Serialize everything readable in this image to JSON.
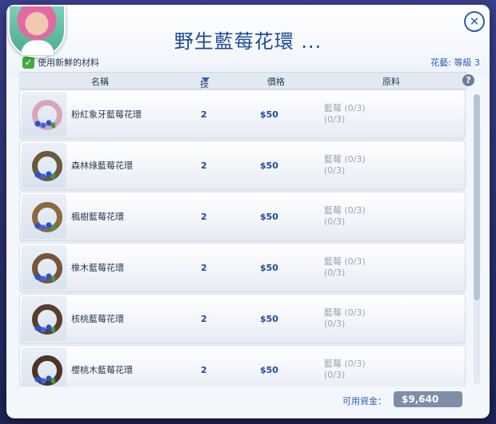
{
  "dialog": {
    "title": "野生藍莓花環 ...",
    "close_glyph": "✕"
  },
  "options": {
    "use_fresh_checked": true,
    "use_fresh_label": "使用新鮮的材料",
    "skill_info": "花藝: 等級 3"
  },
  "table": {
    "headers": {
      "name": "名稱",
      "skill": "技能",
      "price": "價格",
      "ingredients": "原料",
      "help_glyph": "?"
    },
    "rows": [
      {
        "name": "粉紅象牙藍莓花環",
        "skill": "2",
        "price": "$50",
        "ingredient": "藍莓 (0/3)",
        "ingredient_total": "(0/3)"
      },
      {
        "name": "森林綠藍莓花環",
        "skill": "2",
        "price": "$50",
        "ingredient": "藍莓 (0/3)",
        "ingredient_total": "(0/3)"
      },
      {
        "name": "楓樹藍莓花環",
        "skill": "2",
        "price": "$50",
        "ingredient": "藍莓 (0/3)",
        "ingredient_total": "(0/3)"
      },
      {
        "name": "橡木藍莓花環",
        "skill": "2",
        "price": "$50",
        "ingredient": "藍莓 (0/3)",
        "ingredient_total": "(0/3)"
      },
      {
        "name": "核桃藍莓花環",
        "skill": "2",
        "price": "$50",
        "ingredient": "藍莓 (0/3)",
        "ingredient_total": "(0/3)"
      },
      {
        "name": "櫻桃木藍莓花環",
        "skill": "2",
        "price": "$50",
        "ingredient": "藍莓 (0/3)",
        "ingredient_total": "(0/3)"
      }
    ]
  },
  "footer": {
    "funds_label": "可用資金：",
    "funds_value": "$9,640"
  }
}
